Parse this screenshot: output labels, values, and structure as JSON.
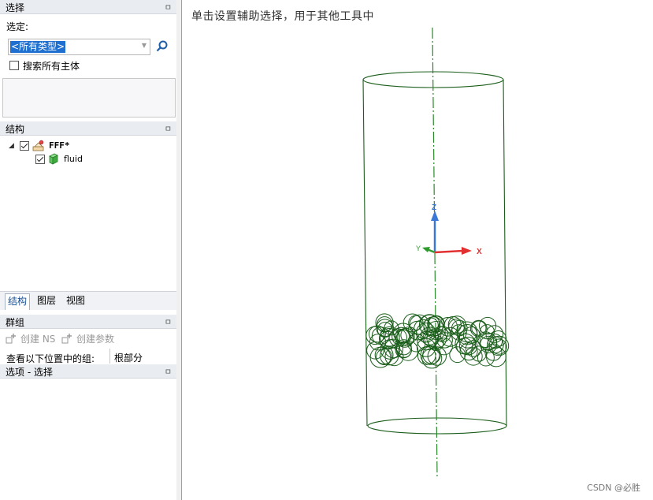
{
  "selection_panel": {
    "title": "选择",
    "select_label": "选定:",
    "type_value": "<所有类型>",
    "search_all_label": "搜索所有主体"
  },
  "structure_panel": {
    "title": "结构",
    "tree": [
      {
        "label": "FFF*",
        "checked": true
      },
      {
        "label": "fluid",
        "checked": true
      }
    ]
  },
  "tabs": [
    {
      "label": "结构",
      "active": true
    },
    {
      "label": "图层",
      "active": false
    },
    {
      "label": "视图",
      "active": false
    }
  ],
  "groups_panel": {
    "title": "群组",
    "create_ns_label": "创建 NS",
    "create_param_label": "创建参数",
    "view_groups_label": "查看以下位置中的组:",
    "view_groups_value": "根部分"
  },
  "options_panel": {
    "title": "选项 - 选择"
  },
  "pin_glyph": "ㅁ",
  "viewport": {
    "hint": "单击设置辅助选择，用于其他工具中",
    "axes": {
      "z": "Z",
      "x": "X",
      "y": "Y"
    },
    "watermark": "CSDN @必胜"
  },
  "colors": {
    "geometry": "#1b5e1b",
    "axis_z": "#3a78d8",
    "axis_x": "#e23030",
    "axis_y": "#2e9a2e",
    "selection_highlight": "#1e6fd0"
  }
}
